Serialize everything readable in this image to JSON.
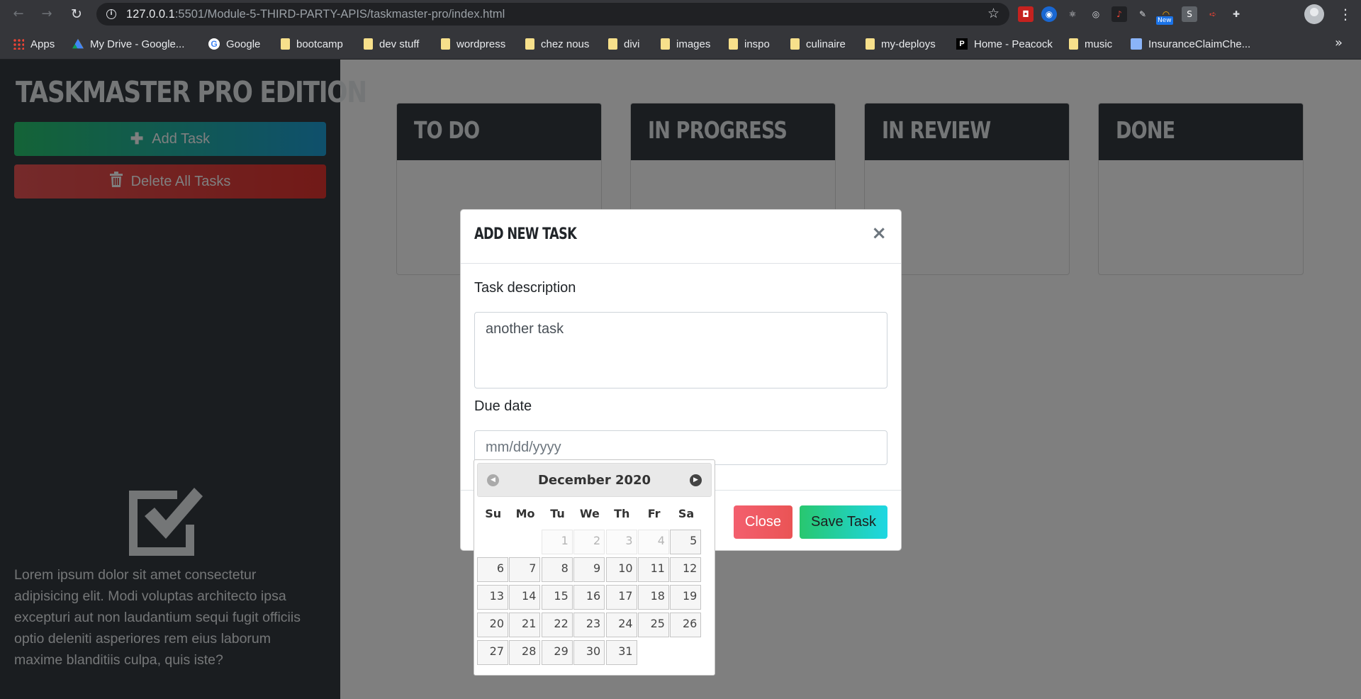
{
  "browser": {
    "url_host": "127.0.0.1",
    "url_path": ":5501/Module-5-THIRD-PARTY-APIS/taskmaster-pro/index.html",
    "extension_badge": "New",
    "bookmarks": [
      {
        "label": "Apps",
        "icon": "apps-grid"
      },
      {
        "label": "My Drive - Google...",
        "icon": "drive-icon"
      },
      {
        "label": "Google",
        "icon": "google-icon"
      },
      {
        "label": "bootcamp",
        "icon": "folder-icon"
      },
      {
        "label": "dev stuff",
        "icon": "folder-icon"
      },
      {
        "label": "wordpress",
        "icon": "folder-icon"
      },
      {
        "label": "chez nous",
        "icon": "folder-icon"
      },
      {
        "label": "divi",
        "icon": "folder-icon"
      },
      {
        "label": "images",
        "icon": "folder-icon"
      },
      {
        "label": "inspo",
        "icon": "folder-icon"
      },
      {
        "label": "culinaire",
        "icon": "folder-icon"
      },
      {
        "label": "my-deploys",
        "icon": "folder-icon"
      },
      {
        "label": "Home - Peacock",
        "icon": "peacock-icon"
      },
      {
        "label": "music",
        "icon": "folder-icon"
      },
      {
        "label": "InsuranceClaimChe...",
        "icon": "page-icon"
      }
    ],
    "more": "»"
  },
  "sidebar": {
    "brand": "Taskmaster Pro Edition",
    "add_task": "Add Task",
    "delete_all": "Delete All Tasks",
    "lorem": "Lorem ipsum dolor sit amet consectetur adipisicing elit. Modi voluptas architecto ipsa excepturi aut non laudantium sequi fugit officiis optio deleniti asperiores rem eius laborum maxime blanditiis culpa, quis iste?"
  },
  "board": {
    "columns": [
      "To Do",
      "In Progress",
      "In Review",
      "Done"
    ]
  },
  "modal": {
    "title": "Add New Task",
    "close_symbol": "×",
    "desc_label": "Task description",
    "desc_value": "another task",
    "date_label": "Due date",
    "date_placeholder": "mm/dd/yyyy",
    "close_btn": "Close",
    "save_btn": "Save Task"
  },
  "datepicker": {
    "month_label": "December 2020",
    "days_of_week": [
      "Su",
      "Mo",
      "Tu",
      "We",
      "Th",
      "Fr",
      "Sa"
    ],
    "weeks": [
      [
        "",
        "",
        "1",
        "2",
        "3",
        "4",
        "5"
      ],
      [
        "6",
        "7",
        "8",
        "9",
        "10",
        "11",
        "12"
      ],
      [
        "13",
        "14",
        "15",
        "16",
        "17",
        "18",
        "19"
      ],
      [
        "20",
        "21",
        "22",
        "23",
        "24",
        "25",
        "26"
      ],
      [
        "27",
        "28",
        "29",
        "30",
        "31",
        "",
        ""
      ]
    ],
    "disabled_days": [
      "1",
      "2",
      "3",
      "4"
    ]
  },
  "colors": {
    "sidebar_bg": "#343a40",
    "add_gradient": [
      "#28c76f",
      "#1ea0d8"
    ],
    "delete_gradient": [
      "#ea5455",
      "#e3342f"
    ],
    "save_gradient": [
      "#28c76f",
      "#1ed7e3"
    ],
    "close_gradient": [
      "#f35f6e",
      "#ea5455"
    ]
  }
}
